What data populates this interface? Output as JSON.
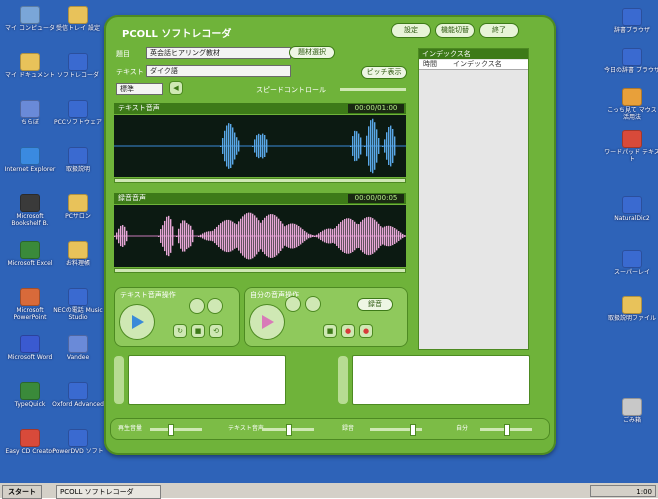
{
  "desktop": {
    "left_icons": [
      {
        "label": "マイ コンピュータ",
        "color": "#7aa6d8"
      },
      {
        "label": "受信トレイ 設定",
        "color": "#e8c25a"
      },
      {
        "label": "マイ ドキュメント",
        "color": "#e8c25a"
      },
      {
        "label": "ソフトレコーダ",
        "color": "#3a6ad0"
      },
      {
        "label": "ちらぼ",
        "color": "#6a8ad8"
      },
      {
        "label": "PCCソフトウェア",
        "color": "#3a6ad0"
      },
      {
        "label": "Internet Explorer",
        "color": "#3a8ae0"
      },
      {
        "label": "取扱説明",
        "color": "#3a6ad0"
      },
      {
        "label": "Microsoft Bookshelf B.",
        "color": "#3a3a3a"
      },
      {
        "label": "PCサロン",
        "color": "#e8c25a"
      },
      {
        "label": "Microsoft Excel",
        "color": "#3a8a3a"
      },
      {
        "label": "お料理帳",
        "color": "#e8c25a"
      },
      {
        "label": "Microsoft PowerPoint",
        "color": "#d86a3a"
      },
      {
        "label": "NECの電話 Music Studio",
        "color": "#3a6ad0"
      },
      {
        "label": "Microsoft Word",
        "color": "#3a5ad0"
      },
      {
        "label": "Vandee",
        "color": "#6a8ad8"
      },
      {
        "label": "TypeQuick",
        "color": "#3a8a3a"
      },
      {
        "label": "Oxford Advanced",
        "color": "#3a6ad0"
      },
      {
        "label": "Easy CD Creator",
        "color": "#d84a3a"
      },
      {
        "label": "PowerDVD ソフト",
        "color": "#3a6ad0"
      }
    ],
    "right_icons": [
      {
        "label": "辞書ブラウザ",
        "color": "#3a6ad0"
      },
      {
        "label": "今日の辞書 ブラウザ",
        "color": "#3a6ad0"
      },
      {
        "label": "こっち見て マウス 活用法",
        "color": "#e8a03a"
      },
      {
        "label": "ワードパッド テキスト",
        "color": "#d84a3a"
      },
      {
        "label": "NaturalDic2",
        "color": "#3a6ad0"
      },
      {
        "label": "スーパーレイ",
        "color": "#3a6ad0"
      },
      {
        "label": "取扱説明ファイル",
        "color": "#e8c25a"
      },
      {
        "label": "ごみ箱",
        "color": "#c8c8c8"
      }
    ]
  },
  "app": {
    "title": "PCOLL ソフトレコーダ",
    "title_buttons": [
      "設定",
      "機能切替",
      "終了"
    ],
    "theme_field_label": "題目",
    "theme_field_value": "英会話ヒアリング教材",
    "theme_button": "題材選択",
    "text_field_label": "テキスト",
    "text_field_value": "ダイク語",
    "speed_select": "標準",
    "pitch_button": "ピッチ表示",
    "speed_label": "スピードコントロール",
    "text_audio_header": "テキスト音声",
    "text_audio_time": "00:00/01:00",
    "record_audio_header": "録音音声",
    "record_audio_time": "00:00/00:05",
    "text_ops_header": "テキスト音声操作",
    "record_ops_header": "自分の音声操作",
    "record_button": "録音",
    "index_header": "インデックス名",
    "index_columns": [
      "時間",
      "インデックス名"
    ],
    "sliders": [
      "再生音量",
      "テキスト音声",
      "録音",
      "自分"
    ]
  },
  "taskbar": {
    "start_label": "スタート",
    "task_label": "PCOLL ソフトレコーダ",
    "clock": "1:00"
  }
}
